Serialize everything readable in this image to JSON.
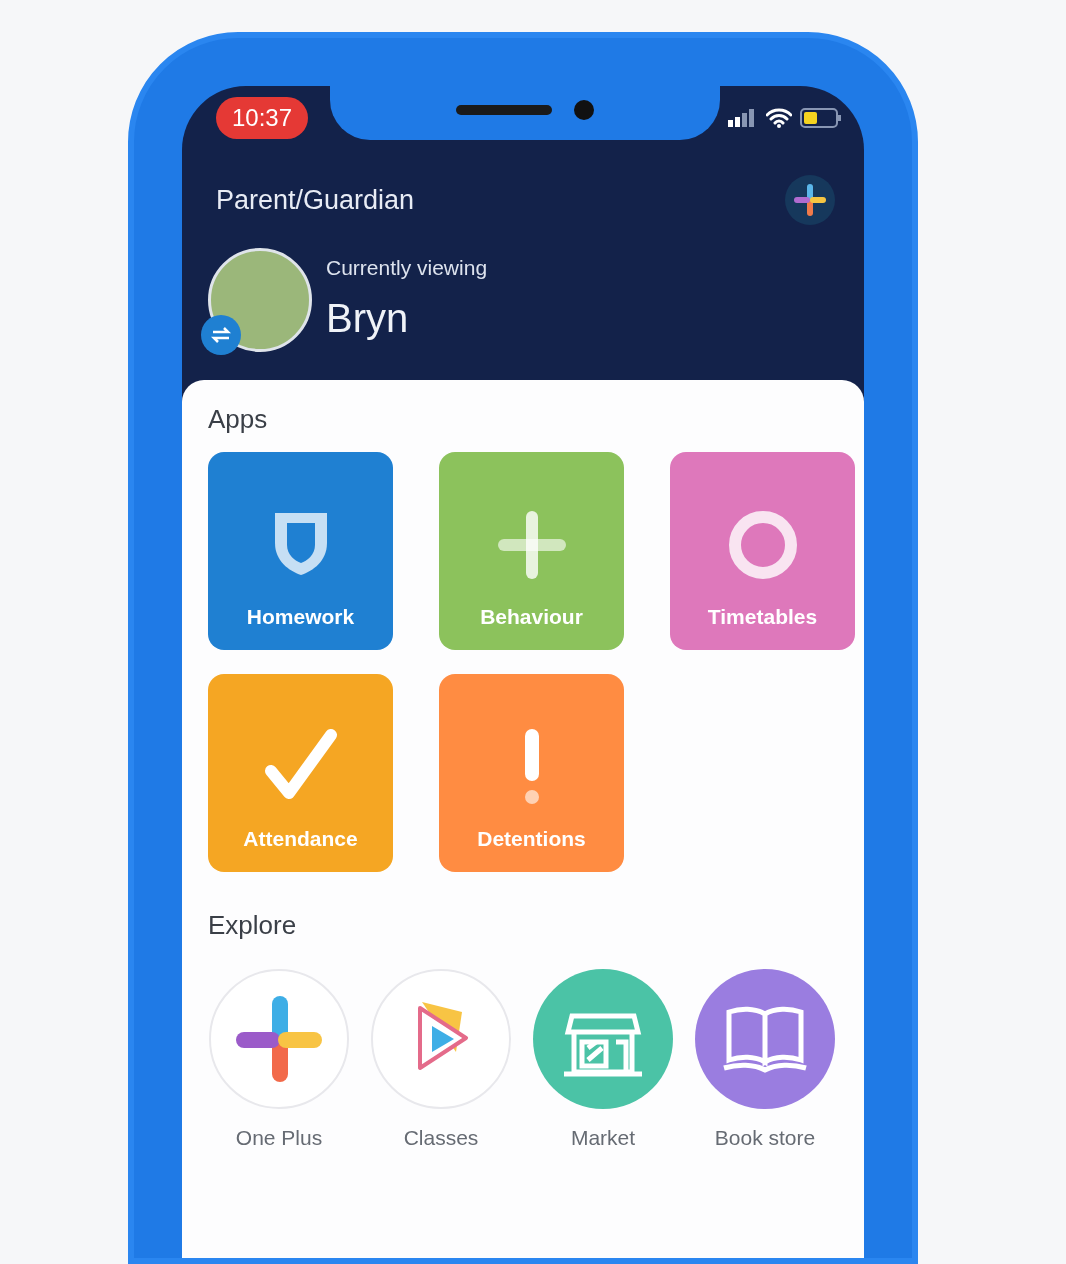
{
  "status_bar": {
    "time": "10:37"
  },
  "header": {
    "title": "Parent/Guardian",
    "viewing_label": "Currently viewing",
    "student_name": "Bryn"
  },
  "apps": {
    "heading": "Apps",
    "items": [
      {
        "label": "Homework",
        "kind": "shield",
        "color": "#1f80d2"
      },
      {
        "label": "Behaviour",
        "kind": "plus",
        "color": "#8cc25c"
      },
      {
        "label": "Timetables",
        "kind": "ring",
        "color": "#de78bb"
      },
      {
        "label": "Attendance",
        "kind": "check",
        "color": "#f5a623"
      },
      {
        "label": "Detentions",
        "kind": "alert",
        "color": "#ff8c42"
      }
    ]
  },
  "explore": {
    "heading": "Explore",
    "items": [
      {
        "label": "One Plus",
        "kind": "cross"
      },
      {
        "label": "Classes",
        "kind": "play"
      },
      {
        "label": "Market",
        "kind": "shop"
      },
      {
        "label": "Book store",
        "kind": "book"
      }
    ]
  }
}
